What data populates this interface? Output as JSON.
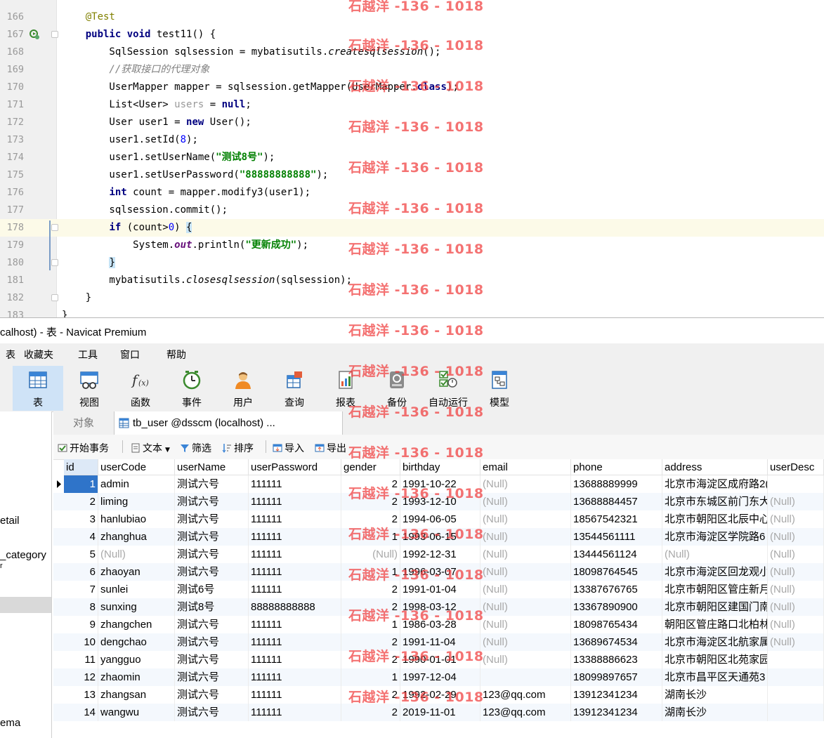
{
  "editor": {
    "lines": [
      {
        "no": "166",
        "code": "    @Test"
      },
      {
        "no": "167",
        "code": "    public void test11() {"
      },
      {
        "no": "168",
        "code": "        SqlSession sqlsession = mybatisutils.createsqlsession();"
      },
      {
        "no": "169",
        "code": "        //获取接口的代理对象"
      },
      {
        "no": "170",
        "code": "        UserMapper mapper = sqlsession.getMapper(UserMapper.class);"
      },
      {
        "no": "171",
        "code": "        List<User> users = null;"
      },
      {
        "no": "172",
        "code": "        User user1 = new User();"
      },
      {
        "no": "173",
        "code": "        user1.setId(8);"
      },
      {
        "no": "174",
        "code": "        user1.setUserName(\"测试8号\");"
      },
      {
        "no": "175",
        "code": "        user1.setUserPassword(\"88888888888\");"
      },
      {
        "no": "176",
        "code": "        int count = mapper.modify3(user1);"
      },
      {
        "no": "177",
        "code": "        sqlsession.commit();"
      },
      {
        "no": "178",
        "code": "        if (count>0) {"
      },
      {
        "no": "179",
        "code": "            System.out.println(\"更新成功\");"
      },
      {
        "no": "180",
        "code": "        }"
      },
      {
        "no": "181",
        "code": "        mybatisutils.closesqlsession(sqlsession);"
      },
      {
        "no": "182",
        "code": "    }"
      },
      {
        "no": "183",
        "code": "}"
      }
    ],
    "highlight_line": "178"
  },
  "window": {
    "title": "calhost) - 表 - Navicat Premium"
  },
  "menu": {
    "items": [
      "表",
      "收藏夹",
      "工具",
      "窗口",
      "帮助"
    ]
  },
  "ribbon": {
    "buttons": [
      {
        "label": "表",
        "icon": "table-icon",
        "active": true
      },
      {
        "label": "视图",
        "icon": "view-icon"
      },
      {
        "label": "函数",
        "icon": "function-icon"
      },
      {
        "label": "事件",
        "icon": "event-clock-icon"
      },
      {
        "label": "用户",
        "icon": "user-icon"
      },
      {
        "label": "查询",
        "icon": "query-icon"
      },
      {
        "label": "报表",
        "icon": "report-icon"
      },
      {
        "label": "备份",
        "icon": "backup-icon"
      },
      {
        "label": "自动运行",
        "icon": "automation-icon"
      },
      {
        "label": "模型",
        "icon": "model-icon"
      }
    ]
  },
  "sidebar": {
    "items": [
      "etail",
      "_category",
      "r",
      "ema"
    ]
  },
  "tabs": {
    "objects": "对象",
    "active": "tb_user @dsscm (localhost) ..."
  },
  "toolbar": {
    "begin_transaction": "开始事务",
    "text": "文本",
    "filter": "筛选",
    "sort": "排序",
    "import": "导入",
    "export": "导出"
  },
  "grid": {
    "columns": [
      "id",
      "userCode",
      "userName",
      "userPassword",
      "gender",
      "birthday",
      "email",
      "phone",
      "address",
      "userDesc"
    ],
    "rows": [
      [
        "1",
        "admin",
        "测试六号",
        "111111",
        "2",
        "1991-10-22",
        "(Null)",
        "13688889999",
        "北京市海淀区成府路2(",
        ""
      ],
      [
        "2",
        "liming",
        "测试六号",
        "111111",
        "2",
        "1993-12-10",
        "(Null)",
        "13688884457",
        "北京市东城区前门东大",
        "(Null)"
      ],
      [
        "3",
        "hanlubiao",
        "测试六号",
        "111111",
        "2",
        "1994-06-05",
        "(Null)",
        "18567542321",
        "北京市朝阳区北辰中心",
        "(Null)"
      ],
      [
        "4",
        "zhanghua",
        "测试六号",
        "111111",
        "1",
        "1993-06-15",
        "(Null)",
        "13544561111",
        "北京市海淀区学院路6",
        "(Null)"
      ],
      [
        "5",
        "(Null)",
        "测试六号",
        "111111",
        "(Null)",
        "1992-12-31",
        "(Null)",
        "13444561124",
        "(Null)",
        "(Null)"
      ],
      [
        "6",
        "zhaoyan",
        "测试六号",
        "111111",
        "1",
        "1996-03-07",
        "(Null)",
        "18098764545",
        "北京市海淀区回龙观小",
        "(Null)"
      ],
      [
        "7",
        "sunlei",
        "测试6号",
        "111111",
        "2",
        "1991-01-04",
        "(Null)",
        "13387676765",
        "北京市朝阳区管庄新月",
        "(Null)"
      ],
      [
        "8",
        "sunxing",
        "测试8号",
        "88888888888",
        "2",
        "1998-03-12",
        "(Null)",
        "13367890900",
        "北京市朝阳区建国门南",
        "(Null)"
      ],
      [
        "9",
        "zhangchen",
        "测试六号",
        "111111",
        "1",
        "1986-03-28",
        "(Null)",
        "18098765434",
        "朝阳区管庄路口北柏林",
        "(Null)"
      ],
      [
        "10",
        "dengchao",
        "测试六号",
        "111111",
        "2",
        "1991-11-04",
        "(Null)",
        "13689674534",
        "北京市海淀区北航家属",
        "(Null)"
      ],
      [
        "11",
        "yangguo",
        "测试六号",
        "111111",
        "2",
        "1990-01-01",
        "(Null)",
        "13388886623",
        "北京市朝阳区北苑家园",
        ""
      ],
      [
        "12",
        "zhaomin",
        "测试六号",
        "111111",
        "1",
        "1997-12-04",
        "",
        "18099897657",
        "北京市昌平区天通苑3",
        ""
      ],
      [
        "13",
        "zhangsan",
        "测试六号",
        "111111",
        "2",
        "1992-02-29",
        "123@qq.com",
        "13912341234",
        "湖南长沙",
        ""
      ],
      [
        "14",
        "wangwu",
        "测试六号",
        "111111",
        "2",
        "2019-11-01",
        "123@qq.com",
        "13912341234",
        "湖南长沙",
        ""
      ]
    ]
  },
  "watermark": {
    "text": "石越洋 -136 - 1018"
  },
  "colors": {
    "keyword": "#000080",
    "string": "#008000",
    "annotation": "#808000",
    "number": "#0000ff",
    "watermark": "#f03c3c",
    "selection": "#2f74c9"
  }
}
